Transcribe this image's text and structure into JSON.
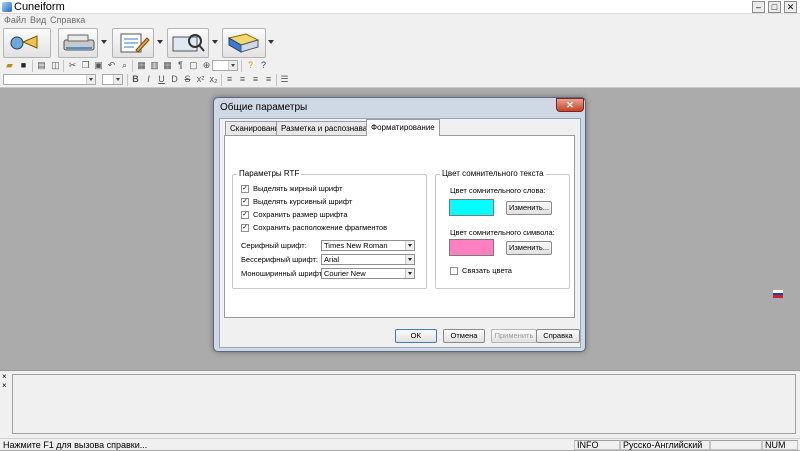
{
  "window": {
    "title": "Cuneiform",
    "min_label": "–",
    "max_label": "□",
    "close_label": "✕"
  },
  "menu": {
    "items": [
      "Файл",
      "Вид",
      "Справка"
    ]
  },
  "workspace": {
    "language_flag_colors": [
      "#ffffff",
      "#1f3fb0",
      "#d2232a"
    ]
  },
  "dialog": {
    "title": "Общие параметры",
    "close_label": "✕",
    "tabs": [
      {
        "label": "Сканирование",
        "active": false
      },
      {
        "label": "Разметка и распознавание",
        "active": false
      },
      {
        "label": "Форматирование",
        "active": true
      }
    ],
    "rtf_group": {
      "title": "Параметры RTF",
      "checkboxes": [
        {
          "label": "Выделять жирный шрифт",
          "checked": true
        },
        {
          "label": "Выделять курсивный шрифт",
          "checked": true
        },
        {
          "label": "Сохранить размер шрифта",
          "checked": true
        },
        {
          "label": "Сохранить расположение фрагментов",
          "checked": true
        }
      ],
      "fonts": [
        {
          "label": "Серифный шрифт:",
          "value": "Times New Roman"
        },
        {
          "label": "Бессерифный шрифт:",
          "value": "Arial"
        },
        {
          "label": "Моноширинный шрифт:",
          "value": "Courier New"
        }
      ]
    },
    "color_group": {
      "title": "Цвет сомнительного текста",
      "word_label": "Цвет сомнительного слова:",
      "word_color": "#00ffff",
      "word_button": "Изменить...",
      "char_label": "Цвет сомнительного символа:",
      "char_color": "#ff80c0",
      "char_button": "Изменить...",
      "link_checkbox": {
        "label": "Связать цвета",
        "checked": false
      }
    },
    "buttons": {
      "ok": "OK",
      "cancel": "Отмена",
      "apply": "Применить",
      "help": "Справка"
    }
  },
  "bottom_pane": {
    "close_icon": "×"
  },
  "statusbar": {
    "help_text": "Нажмите F1 для вызова справки...",
    "info": "INFO",
    "language": "Русско-Английский",
    "num": "NUM"
  },
  "icons": {
    "checkmark": "✓"
  }
}
